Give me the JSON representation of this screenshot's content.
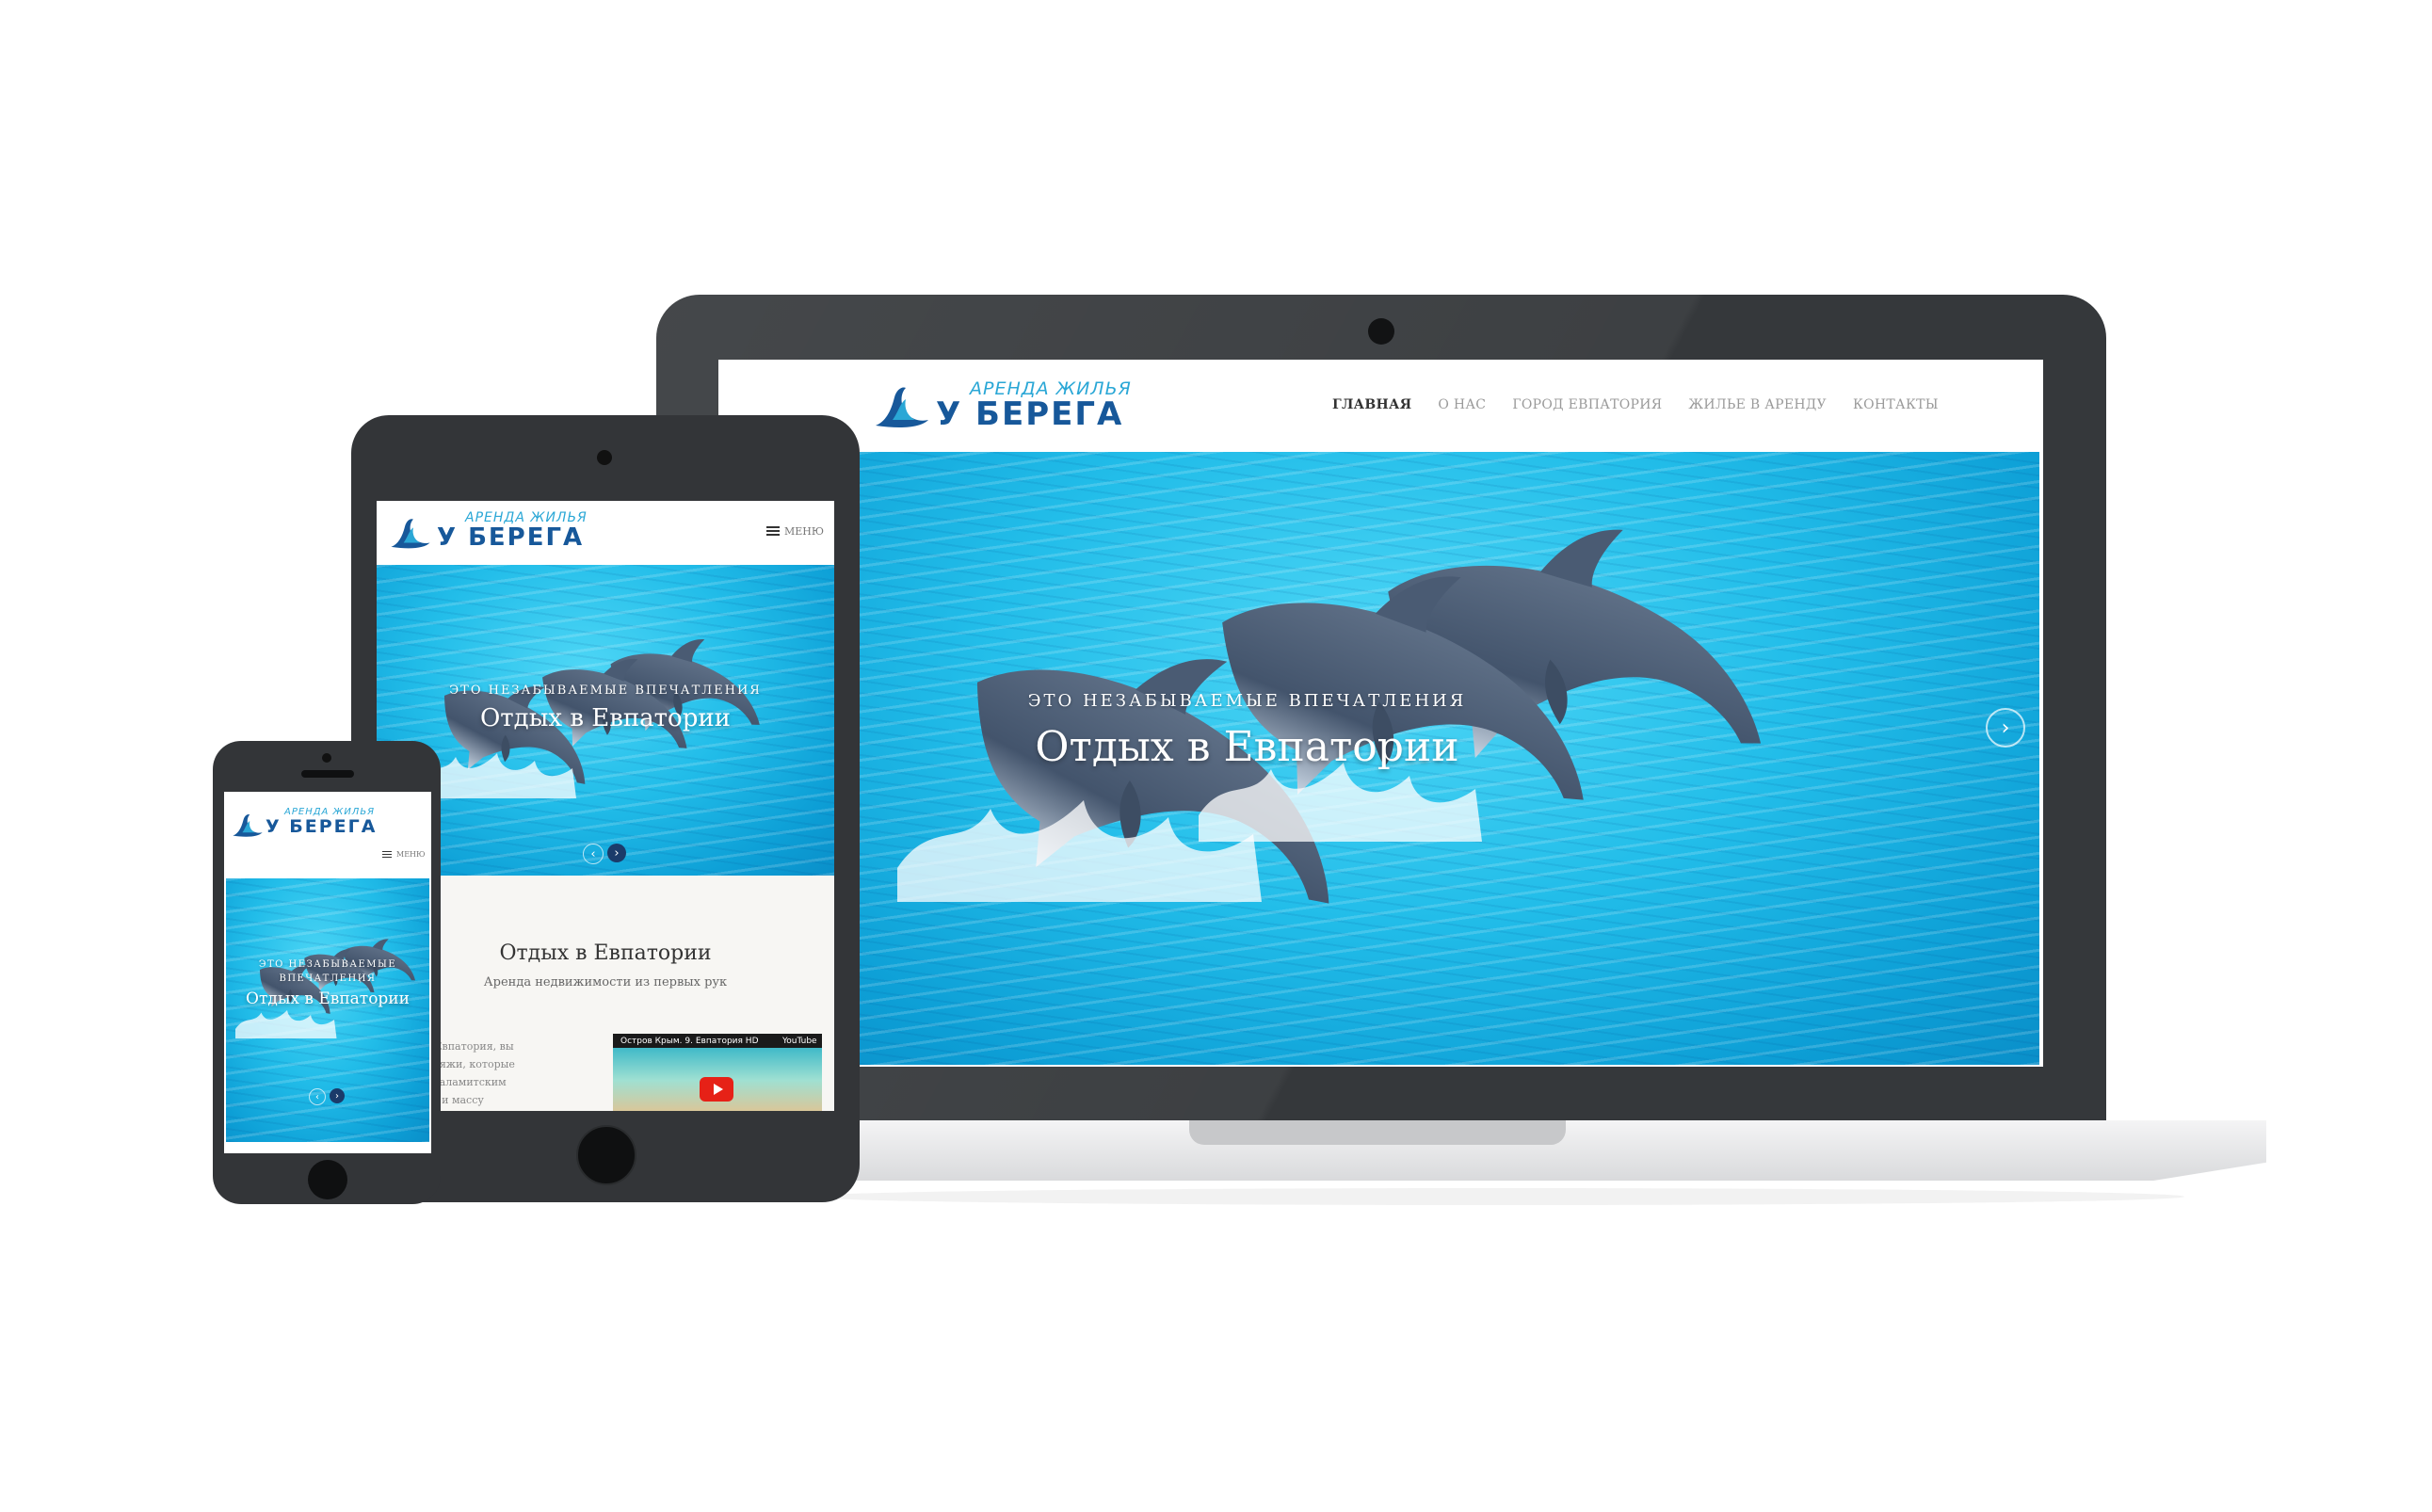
{
  "site": {
    "logo_top": "АРЕНДА ЖИЛЬЯ",
    "logo_main": "У БЕРЕГА"
  },
  "nav": [
    {
      "label": "ГЛАВНАЯ",
      "active": true
    },
    {
      "label": "О НАС",
      "active": false
    },
    {
      "label": "ГОРОД ЕВПАТОРИЯ",
      "active": false
    },
    {
      "label": "ЖИЛЬЕ В АРЕНДУ",
      "active": false
    },
    {
      "label": "КОНТАКТЫ",
      "active": false
    }
  ],
  "menu_label": "МЕНЮ",
  "hero": {
    "subtitle": "ЭТО НЕЗАБЫВАЕМЫЕ ВПЕЧАТЛЕНИЯ",
    "subtitle_line1": "ЭТО НЕЗАБЫВАЕМЫЕ",
    "subtitle_line2": "ВПЕЧАТЛЕНИЯ",
    "title": "Отдых в Евпатории",
    "prev_icon": "chevron-left-icon",
    "next_icon": "chevron-right-icon"
  },
  "intro": {
    "title": "Отдых в Евпатории",
    "subtitle": "Аренда недвижимости из первых рук",
    "text_lines": [
      "ом городе Евпатория, вы",
      "есочные пляжи, которые",
      "я теплым Каламитским",
      "бного моря и массу"
    ]
  },
  "video": {
    "title": "Остров Крым. 9. Евпатория HD",
    "brand": "YouTube",
    "play_icon": "play-icon"
  },
  "colors": {
    "logo_light": "#2aa7d6",
    "logo_dark": "#17589a",
    "device_frame": "#35383b",
    "water": "#22bde9"
  }
}
